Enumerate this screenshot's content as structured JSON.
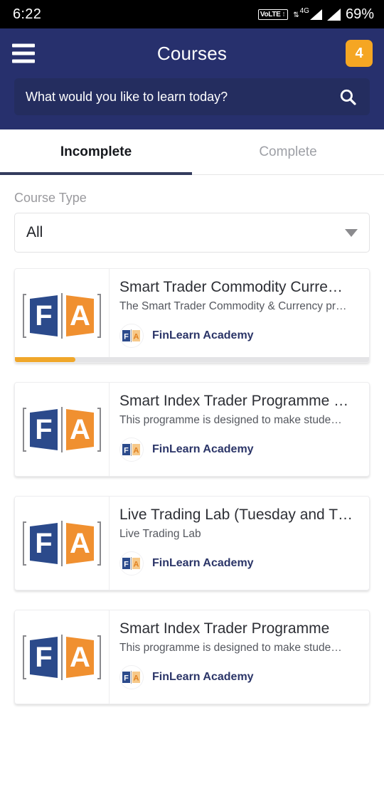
{
  "status_bar": {
    "time": "6:22",
    "volte_label": "VoLTE",
    "network_type": "4G",
    "battery": "69%"
  },
  "app_bar": {
    "menu_icon": "hamburger-menu-icon",
    "title": "Courses",
    "badge_count": "4"
  },
  "search": {
    "placeholder": "What would you like to learn today?",
    "value": "",
    "icon": "search-icon"
  },
  "tabs": [
    {
      "label": "Incomplete",
      "active": true
    },
    {
      "label": "Complete",
      "active": false
    }
  ],
  "filter": {
    "label": "Course Type",
    "selected": "All",
    "icon": "chevron-down-icon"
  },
  "courses": [
    {
      "title": "Smart Trader Commodity Curre…",
      "description": "The Smart Trader Commodity & Currency pr…",
      "provider": "FinLearn Academy",
      "progress_percent": 17,
      "has_progress": true
    },
    {
      "title": "Smart Index Trader Programme …",
      "description": "This programme is designed to make stude…",
      "provider": "FinLearn Academy",
      "progress_percent": 0,
      "has_progress": false
    },
    {
      "title": "Live Trading Lab (Tuesday and T…",
      "description": "Live Trading Lab",
      "provider": "FinLearn Academy",
      "progress_percent": 0,
      "has_progress": false
    },
    {
      "title": "Smart Index Trader Programme",
      "description": "This programme is designed to make stude…",
      "provider": "FinLearn Academy",
      "progress_percent": 0,
      "has_progress": false
    }
  ],
  "colors": {
    "header_blue": "#27306D",
    "search_field": "#242D5F",
    "accent_orange": "#F5A623",
    "progress_orange": "#F0A72A",
    "tab_underline": "#343C5E",
    "logo_blue": "#2B4A8B",
    "logo_orange": "#F09030"
  }
}
